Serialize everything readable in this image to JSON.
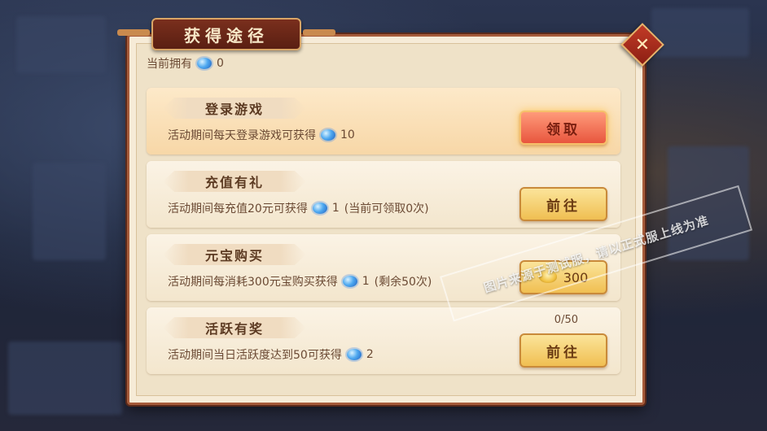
{
  "window": {
    "title": "获得途径"
  },
  "owned": {
    "label": "当前拥有",
    "count": "0"
  },
  "cards": [
    {
      "title": "登录游戏",
      "desc": "活动期间每天登录游戏可获得",
      "reward": "10",
      "extra": "",
      "button": "领取",
      "progress": ""
    },
    {
      "title": "充值有礼",
      "desc": "活动期间每充值20元可获得",
      "reward": "1",
      "extra": "(当前可领取0次)",
      "button": "前往",
      "progress": ""
    },
    {
      "title": "元宝购买",
      "desc": "活动期间每消耗300元宝购买获得",
      "reward": "1",
      "extra": "(剩余50次)",
      "button": "300",
      "progress": ""
    },
    {
      "title": "活跃有奖",
      "desc": "活动期间当日活跃度达到50可获得",
      "reward": "2",
      "extra": "",
      "button": "前往",
      "progress": "0/50"
    }
  ],
  "watermark": "图片来源于测试服，请以正式服上线为准",
  "icons": {
    "currency": "blue-orb-icon",
    "ingot": "gold-ingot-icon",
    "close": "close-icon"
  },
  "colors": {
    "panel_border": "#a65b3a",
    "claim_button": "#e8563e",
    "go_button": "#f0bf52"
  }
}
